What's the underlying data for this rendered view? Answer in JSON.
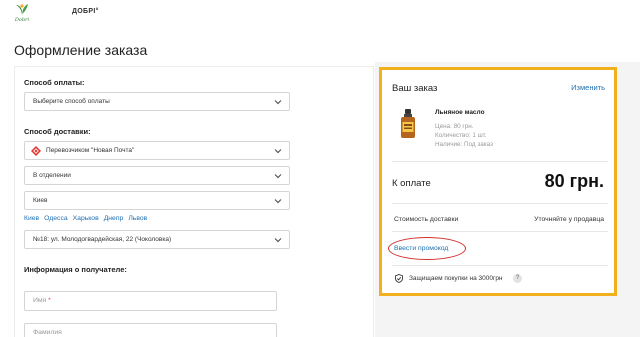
{
  "header": {
    "logo_text": "Dobri",
    "brand": "ДОБРІ°"
  },
  "page_title": "Оформление заказа",
  "payment": {
    "label": "Способ оплаты:",
    "selected": "Выберите способ оплаты"
  },
  "delivery": {
    "label": "Способ доставки:",
    "carrier": "Перевозчиком \"Новая Почта\"",
    "delivery_type": "В отделении",
    "city": "Киев",
    "quick_cities": [
      "Киев",
      "Одесса",
      "Харьков",
      "Днепр",
      "Львов"
    ],
    "branch": "№18: ул. Молодогвардейская, 22 (Чоколовка)"
  },
  "recipient": {
    "label": "Информация о получателе:",
    "name_placeholder": "Имя",
    "surname_placeholder": "Фамилия"
  },
  "order": {
    "title": "Ваш заказ",
    "change_label": "Изменить",
    "product_name": "Льняное масло",
    "price_line": "Цена: 80 грн.",
    "qty_line": "Количество: 1 шт.",
    "stock_line": "Наличие: Под заказ",
    "total_label": "К оплате",
    "total_value": "80 грн.",
    "shipping_label": "Стоимость доставки",
    "shipping_value": "Уточняйте у продавца",
    "promo_label": "Ввести промокод",
    "protection_text": "Защищаем покупки на 3000грн",
    "help_glyph": "?"
  },
  "colors": {
    "accent_link": "#1f6fb2",
    "order_highlight": "#f2b01e",
    "annotation_red": "#d32f2f",
    "required_star": "#e53935"
  }
}
